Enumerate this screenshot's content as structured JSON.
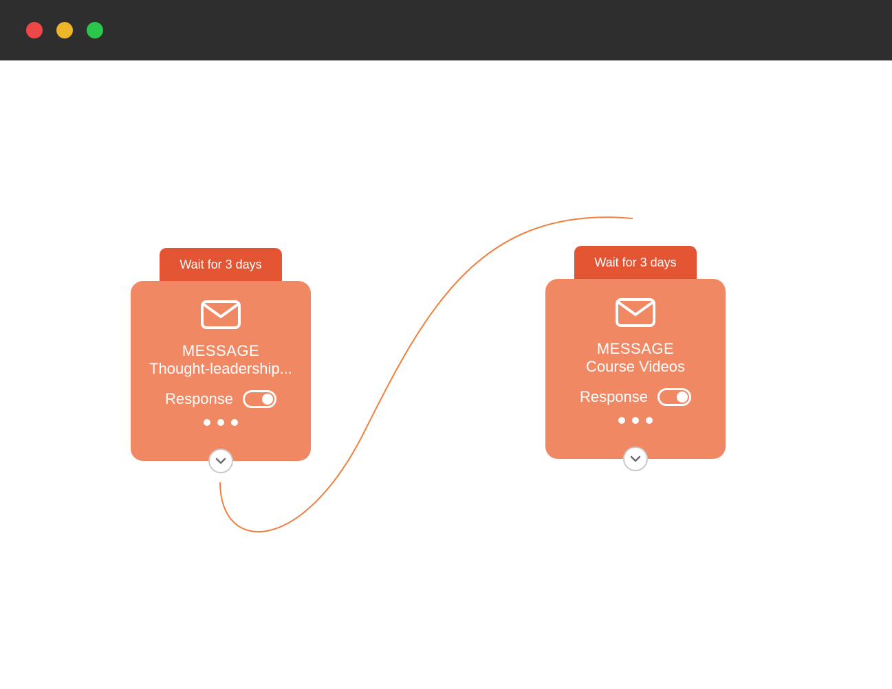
{
  "colors": {
    "title_bar": "#2e2e2e",
    "wait_tab": "#e35432",
    "card": "#f18864",
    "connector": "#f07e3c",
    "traffic_red": "#ed4747",
    "traffic_yellow": "#f0b62a",
    "traffic_green": "#2bc64b"
  },
  "nodes": [
    {
      "wait_label": "Wait for 3 days",
      "type_label": "MESSAGE",
      "title": "Thought-leadership...",
      "response_label": "Response",
      "response_on": true
    },
    {
      "wait_label": "Wait for 3 days",
      "type_label": "MESSAGE",
      "title": "Course Videos",
      "response_label": "Response",
      "response_on": true
    }
  ]
}
